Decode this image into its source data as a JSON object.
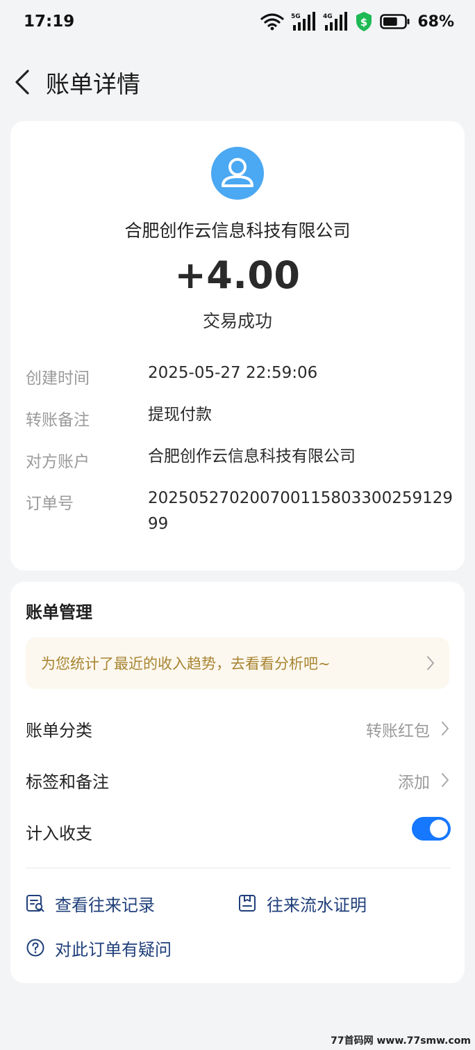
{
  "status_bar": {
    "time": "17:19",
    "network_5g": "5G",
    "network_4g": "4G",
    "battery_percent": "68%",
    "battery_level": 0.68
  },
  "header": {
    "title": "账单详情"
  },
  "transaction": {
    "payer_name": "合肥创作云信息科技有限公司",
    "amount": "+4.00",
    "status": "交易成功",
    "details": [
      {
        "label": "创建时间",
        "value": "2025-05-27 22:59:06"
      },
      {
        "label": "转账备注",
        "value": "提现付款"
      },
      {
        "label": "对方账户",
        "value": "合肥创作云信息科技有限公司"
      },
      {
        "label": "订单号",
        "value": "20250527020070011580330025912999"
      }
    ]
  },
  "management": {
    "title": "账单管理",
    "insight_text": "为您统计了最近的收入趋势，去看看分析吧~",
    "rows": [
      {
        "label": "账单分类",
        "value": "转账红包"
      },
      {
        "label": "标签和备注",
        "value": "添加"
      },
      {
        "label": "计入收支",
        "toggle_on": true
      }
    ],
    "links": {
      "history": "查看往来记录",
      "statement": "往来流水证明",
      "question": "对此订单有疑问"
    }
  },
  "watermark": "77首码网 www.77smw.com",
  "colors": {
    "accent": "#1677ff",
    "avatar_bg": "#4ba8f2",
    "insight_text": "#a88431",
    "link_text": "#1f3f7a",
    "shield": "#1db954"
  },
  "icons": [
    "wifi-icon",
    "signal-icon",
    "shield-icon",
    "battery-icon",
    "back-arrow-icon",
    "avatar-icon",
    "chevron-right-icon",
    "record-list-icon",
    "statement-icon",
    "question-icon"
  ]
}
